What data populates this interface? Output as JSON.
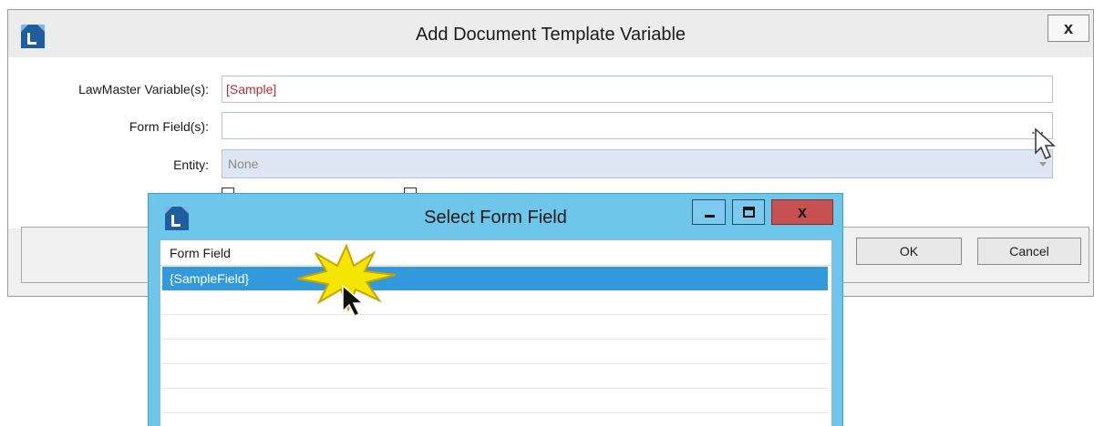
{
  "main_dialog": {
    "title": "Add Document Template Variable",
    "close_glyph": "x",
    "fields": {
      "lawmaster_label": "LawMaster Variable(s):",
      "lawmaster_value": "[Sample]",
      "form_field_label": "Form Field(s):",
      "form_field_value": "",
      "ellipsis": "...",
      "entity_label": "Entity:",
      "entity_value": "None"
    },
    "buttons": {
      "ok": "OK",
      "cancel": "Cancel"
    }
  },
  "popup": {
    "title": "Select Form Field",
    "close_glyph": "x",
    "grid": {
      "header": "Form Field",
      "rows": [
        "{SampleField}",
        "",
        "",
        "",
        "",
        "",
        ""
      ]
    }
  },
  "icons": {
    "app_logo": "lawmaster-logo-icon",
    "minimize": "minimize-icon",
    "maximize": "maximize-icon",
    "close": "close-icon",
    "cursor": "mouse-pointer-icon",
    "highlight": "starburst-highlight"
  },
  "colors": {
    "popup_titlebar": "#6ec6ea",
    "selection": "#3399dd",
    "close_button": "#c75050",
    "required_text": "#b03030",
    "highlight_burst": "#f5e600"
  }
}
